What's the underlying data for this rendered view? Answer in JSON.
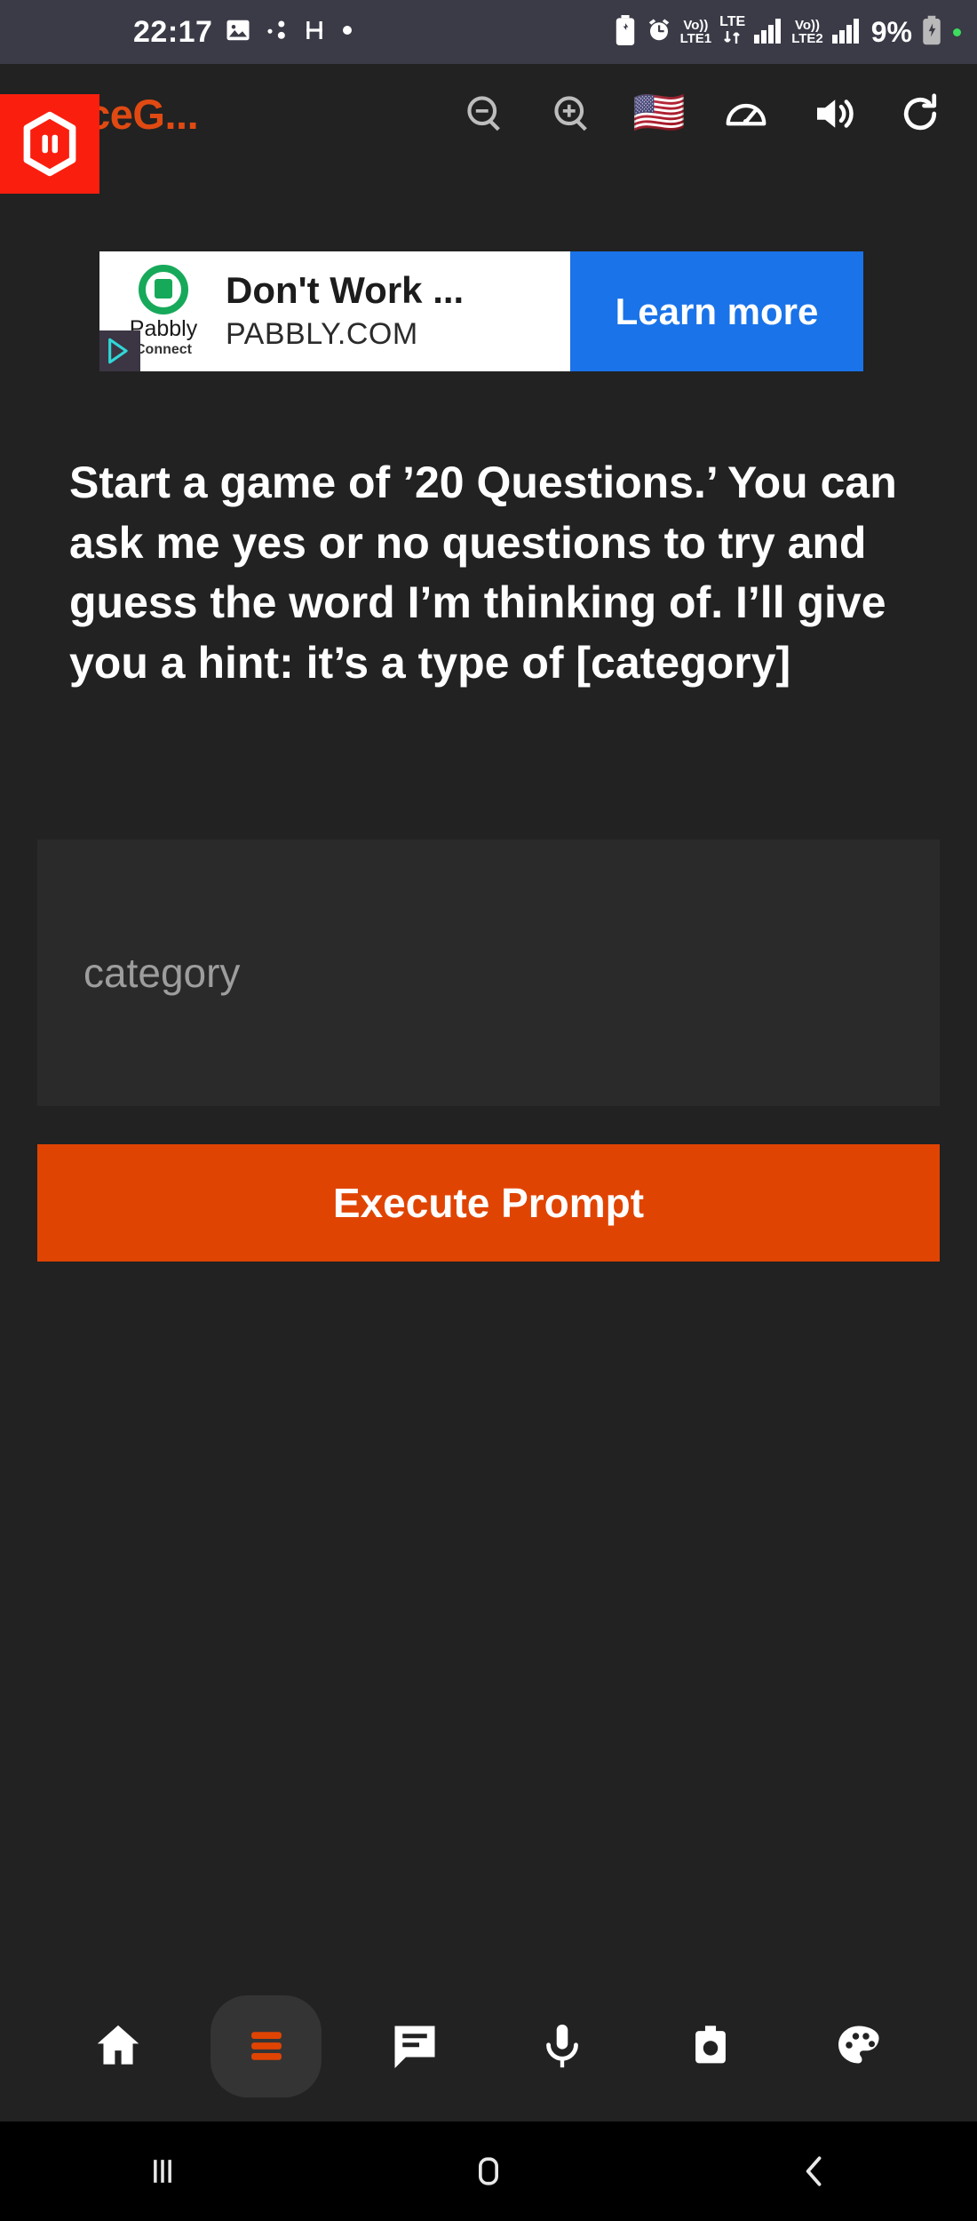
{
  "status_bar": {
    "time": "22:17",
    "left_icons": [
      "image-icon",
      "share-nodes-icon",
      "h-glyph-icon",
      "dot-icon"
    ],
    "right_icons": [
      "battery-saver-icon",
      "alarm-clock-icon"
    ],
    "sim1": {
      "volte": "Vo))",
      "label": "LTE1",
      "network": "LTE"
    },
    "sim2": {
      "volte": "Vo))",
      "label": "LTE2"
    },
    "battery_percent": "9%",
    "battery_state": "charging"
  },
  "app_bar": {
    "title": "VoiceG...",
    "logo": "hexagon-pause-logo",
    "title_color": "#e04a12",
    "toolbar": [
      {
        "name": "zoom-out-icon",
        "label": "Zoom out"
      },
      {
        "name": "zoom-in-icon",
        "label": "Zoom in"
      },
      {
        "name": "language-flag-icon",
        "label": "🇺🇸"
      },
      {
        "name": "speed-gauge-icon",
        "label": "Speed"
      },
      {
        "name": "volume-icon",
        "label": "Volume"
      },
      {
        "name": "refresh-icon",
        "label": "Refresh"
      }
    ]
  },
  "ad": {
    "advertiser": "Pabbly",
    "advertiser_sub": "Connect",
    "headline": "Don't Work ...",
    "url": "PABBLY.COM",
    "cta": "Learn more",
    "cta_color": "#1a73e8",
    "adchoices": "adchoices-icon"
  },
  "main": {
    "prompt": "Start a game of ’20 Questions.’ You can ask me yes or no questions to try and guess the word I’m thinking of. I’ll give you a hint: it’s a type of [category]",
    "input_placeholder": "category",
    "execute_label": "Execute Prompt",
    "accent_color": "#e04403"
  },
  "bottom_nav": {
    "items": [
      {
        "name": "home-icon",
        "label": "Home",
        "active": false
      },
      {
        "name": "menu-icon",
        "label": "Menu",
        "active": true
      },
      {
        "name": "chat-icon",
        "label": "Chat",
        "active": false
      },
      {
        "name": "microphone-icon",
        "label": "Voice",
        "active": false
      },
      {
        "name": "camera-icon",
        "label": "Camera",
        "active": false
      },
      {
        "name": "palette-icon",
        "label": "Theme",
        "active": false
      }
    ]
  },
  "system_nav": {
    "recents": "recents-icon",
    "home": "home-square-icon",
    "back": "back-chevron-icon"
  }
}
